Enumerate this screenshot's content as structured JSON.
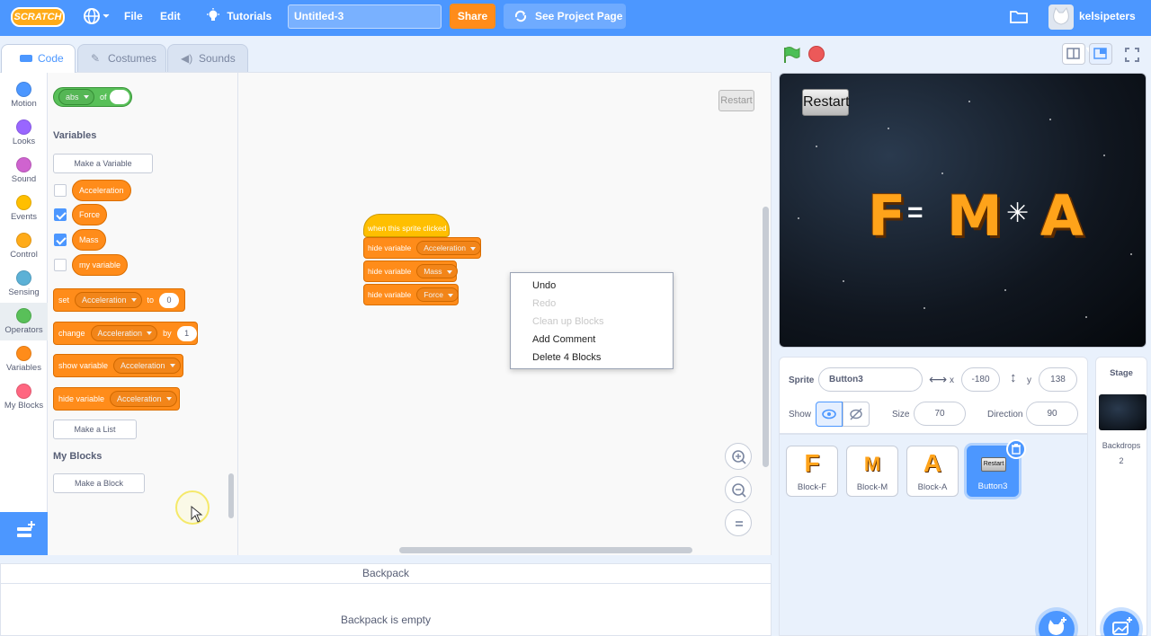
{
  "menubar": {
    "logo": "SCRATCH",
    "file": "File",
    "edit": "Edit",
    "tutorials": "Tutorials",
    "title_value": "Untitled-3",
    "share": "Share",
    "see_project": "See Project Page",
    "username": "kelsipeters"
  },
  "tabs": {
    "code": "Code",
    "costumes": "Costumes",
    "sounds": "Sounds"
  },
  "categories": [
    {
      "label": "Motion",
      "color": "#4c97ff"
    },
    {
      "label": "Looks",
      "color": "#9966ff"
    },
    {
      "label": "Sound",
      "color": "#cf63cf"
    },
    {
      "label": "Events",
      "color": "#ffbf00"
    },
    {
      "label": "Control",
      "color": "#ffab19"
    },
    {
      "label": "Sensing",
      "color": "#5cb1d6"
    },
    {
      "label": "Operators",
      "color": "#59c059"
    },
    {
      "label": "Variables",
      "color": "#ff8c1a"
    },
    {
      "label": "My Blocks",
      "color": "#ff6680"
    }
  ],
  "palette": {
    "abs_block": {
      "op": "abs",
      "of": "of"
    },
    "variables_heading": "Variables",
    "make_variable": "Make a Variable",
    "variables": [
      {
        "name": "Acceleration",
        "checked": false
      },
      {
        "name": "Force",
        "checked": true
      },
      {
        "name": "Mass",
        "checked": true
      },
      {
        "name": "my variable",
        "checked": false
      }
    ],
    "set_block": {
      "kw": "set",
      "var": "Acceleration",
      "to": "to",
      "value": "0"
    },
    "change_block": {
      "kw": "change",
      "var": "Acceleration",
      "by": "by",
      "value": "1"
    },
    "show_block": {
      "kw": "show variable",
      "var": "Acceleration"
    },
    "hide_block": {
      "kw": "hide variable",
      "var": "Acceleration"
    },
    "make_list": "Make a List",
    "myblocks_heading": "My Blocks",
    "make_block": "Make a Block"
  },
  "script": {
    "hat": "when this sprite clicked",
    "blocks": [
      {
        "kw": "hide variable",
        "var": "Acceleration"
      },
      {
        "kw": "hide variable",
        "var": "Mass"
      },
      {
        "kw": "hide variable",
        "var": "Force"
      }
    ],
    "restart_ghost": "Restart"
  },
  "context_menu": {
    "items": [
      {
        "label": "Undo",
        "enabled": true
      },
      {
        "label": "Redo",
        "enabled": false
      },
      {
        "label": "Clean up Blocks",
        "enabled": false
      },
      {
        "label": "Add Comment",
        "enabled": true
      },
      {
        "label": "Delete 4 Blocks",
        "enabled": true
      }
    ]
  },
  "backpack": {
    "header": "Backpack",
    "empty": "Backpack is empty"
  },
  "stage": {
    "restart": "Restart",
    "letters": [
      "F",
      "M",
      "A"
    ],
    "symbols": [
      "=",
      "✳"
    ]
  },
  "sprite_info": {
    "sprite_label": "Sprite",
    "sprite_name": "Button3",
    "x_label": "x",
    "x_value": "-180",
    "y_label": "y",
    "y_value": "138",
    "show_label": "Show",
    "size_label": "Size",
    "size_value": "70",
    "direction_label": "Direction",
    "direction_value": "90"
  },
  "sprites": [
    {
      "name": "Block-F",
      "thumb": "F",
      "selected": false
    },
    {
      "name": "Block-M",
      "thumb": "M",
      "selected": false
    },
    {
      "name": "Block-A",
      "thumb": "A",
      "selected": false
    },
    {
      "name": "Button3",
      "thumb": "Restart",
      "selected": true
    }
  ],
  "stage_panel": {
    "title": "Stage",
    "backdrops_label": "Backdrops",
    "backdrops_count": "2"
  },
  "colors": {
    "brand": "#4c97ff",
    "variables": "#ff8c1a",
    "events": "#ffbf00",
    "share": "#ff8c1a"
  }
}
